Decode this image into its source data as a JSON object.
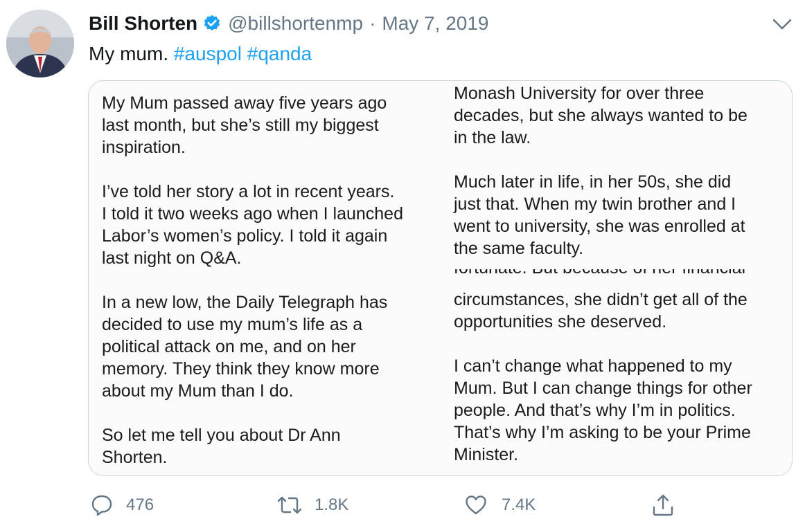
{
  "tweet": {
    "author_name": "Bill Shorten",
    "handle": "@billshortenmp",
    "separator": "·",
    "date": "May 7, 2019",
    "text_prefix": "My mum.",
    "hashtags": [
      "#auspol",
      "#qanda"
    ],
    "icons": {
      "avatar": "avatar-photo",
      "verified": "verified-badge-icon",
      "menu": "chevron-down-icon"
    },
    "colors": {
      "link": "#1da1f2",
      "verified": "#1da1f2",
      "muted": "#657786"
    }
  },
  "image": {
    "left_paragraphs": [
      "My Mum passed away five years ago\nlast month, but she’s still my biggest\ninspiration.",
      "I’ve told her story a lot in recent years.\nI told it two weeks ago when I launched\nLabor’s women’s policy. I told it again\nlast night on Q&A.",
      "In a new low, the Daily Telegraph has\ndecided to use my mum’s life as a\npolitical attack on me, and on her\nmemory. They think they know more\nabout my Mum than I do.",
      "So let me tell you about Dr Ann\nShorten."
    ],
    "right_top_paragraphs": [
      "Monash University for over three\ndecades, but she always wanted to be\nin the law.",
      "Much later in life, in her 50s, she did\njust that. When my twin brother and I\nwent to university, she was enrolled at\nthe same faculty."
    ],
    "right_cut_line": "fortunate. But because of her financial",
    "right_bottom_paragraphs": [
      "circumstances, she didn’t get all of the\nopportunities she deserved.",
      "I can’t change what happened to my\nMum. But I can change things for other\npeople. And that’s why I’m in politics.\nThat’s why I’m asking to be your Prime\nMinister."
    ]
  },
  "actions": {
    "reply_count": "476",
    "retweet_count": "1.8K",
    "like_count": "7.4K",
    "icons": [
      "reply-icon",
      "retweet-icon",
      "like-icon",
      "share-icon"
    ]
  }
}
